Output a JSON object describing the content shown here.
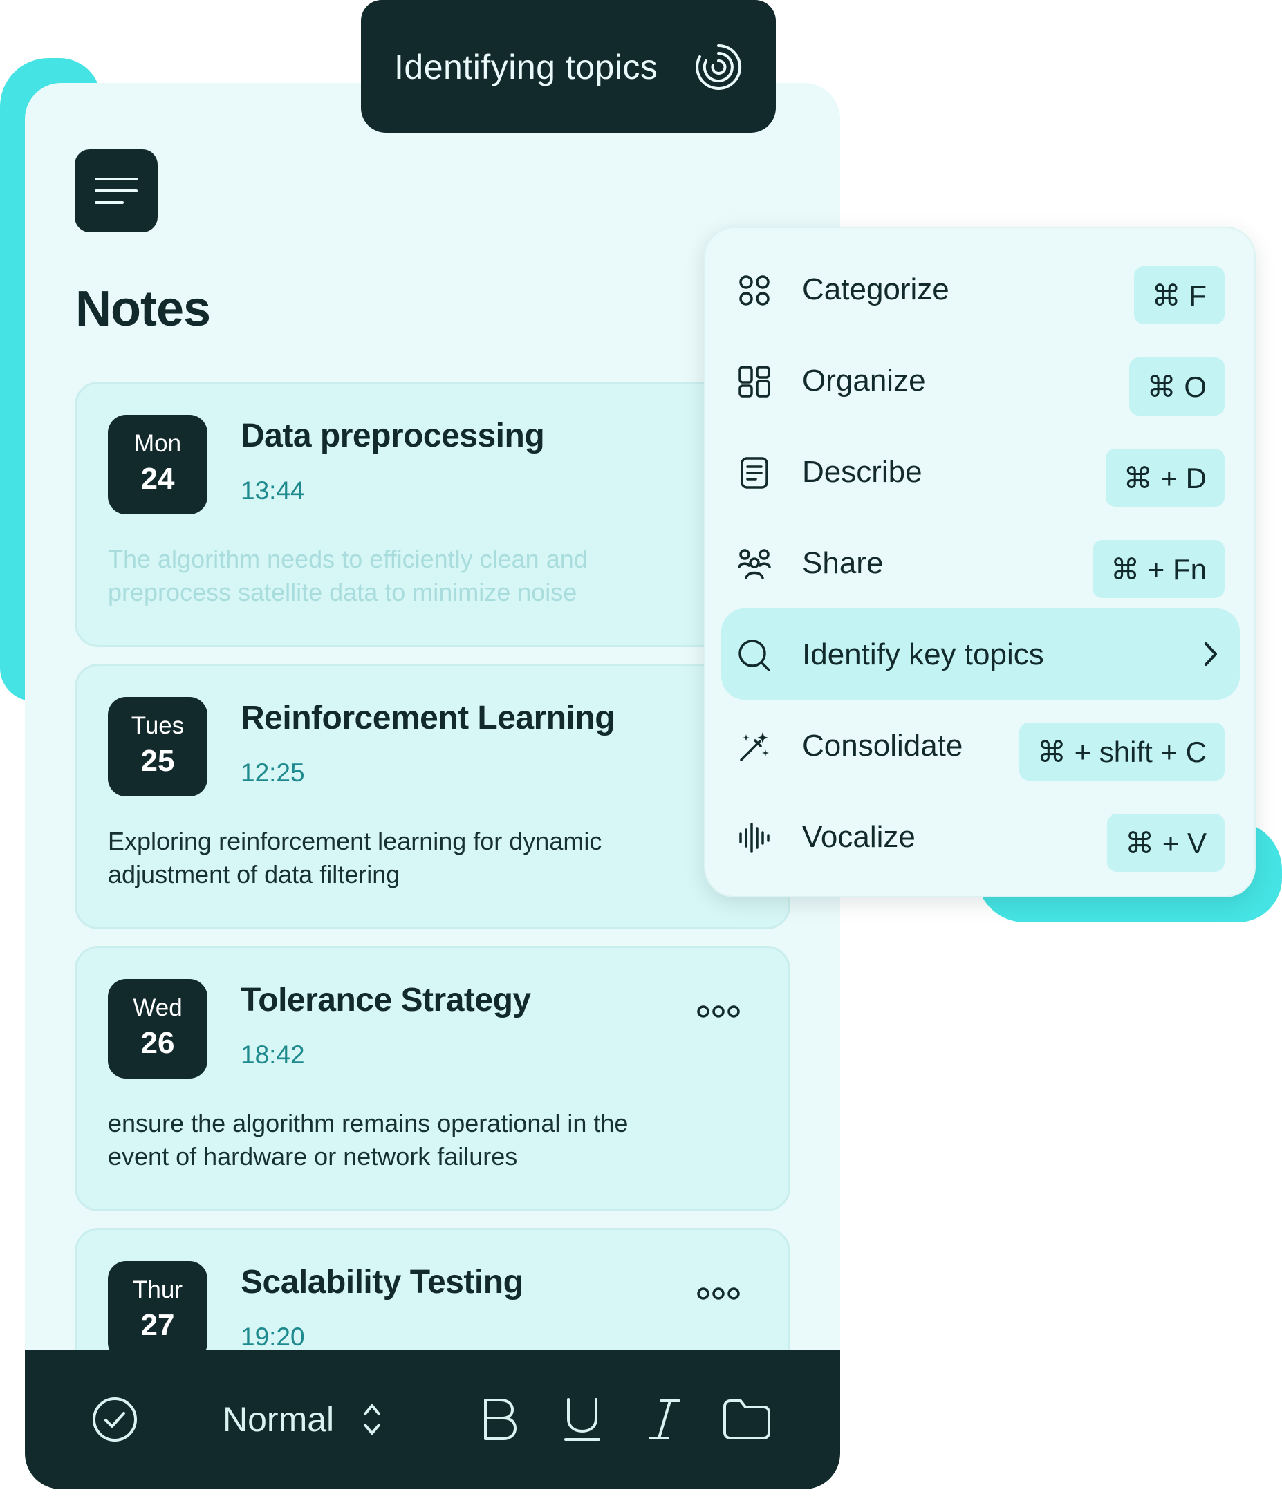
{
  "status_pill": {
    "text": "Identifying topics"
  },
  "page": {
    "title": "Notes"
  },
  "notes": [
    {
      "dow": "Mon",
      "day": "24",
      "title": "Data preprocessing",
      "time": "13:44",
      "body": "The algorithm needs to efficiently clean and preprocess satellite data to minimize noise"
    },
    {
      "dow": "Tues",
      "day": "25",
      "title": "Reinforcement Learning",
      "time": "12:25",
      "body": "Exploring reinforcement learning for dynamic adjustment of data filtering"
    },
    {
      "dow": "Wed",
      "day": "26",
      "title": "Tolerance Strategy",
      "time": "18:42",
      "body": "ensure the algorithm remains operational in the event of hardware or network failures"
    },
    {
      "dow": "Thur",
      "day": "27",
      "title": "Scalability Testing",
      "time": "19:20",
      "body": ""
    }
  ],
  "toolbar": {
    "text_style": "Normal"
  },
  "context_menu": {
    "items": [
      {
        "label": "Categorize",
        "shortcut": "⌘ F",
        "icon": "grid-icon"
      },
      {
        "label": "Organize",
        "shortcut": "⌘ O",
        "icon": "dashboard-icon"
      },
      {
        "label": "Describe",
        "shortcut": "⌘ + D",
        "icon": "document-icon"
      },
      {
        "label": "Share",
        "shortcut": "⌘ + Fn",
        "icon": "people-icon"
      },
      {
        "label": "Identify key topics",
        "shortcut": "",
        "icon": "search-icon",
        "active": true
      },
      {
        "label": "Consolidate",
        "shortcut": "⌘ + shift + C",
        "icon": "magic-wand-icon"
      },
      {
        "label": "Vocalize",
        "shortcut": "⌘ + V",
        "icon": "waveform-icon"
      }
    ]
  },
  "colors": {
    "dark": "#132A2C",
    "accent": "#45E3E3",
    "panel": "#EAF9F9",
    "card": "#D7F6F6",
    "time": "#1F8A8E"
  }
}
